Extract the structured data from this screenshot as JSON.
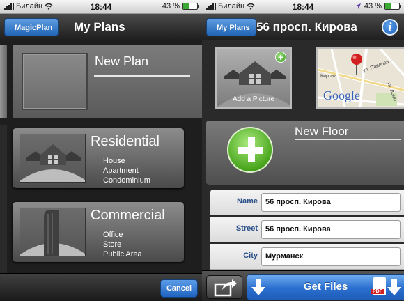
{
  "status_left": {
    "carrier": "Билайн",
    "time": "18:44",
    "battery": "43 %",
    "battery_level": 0.43
  },
  "status_right": {
    "carrier": "Билайн",
    "time": "18:44",
    "battery": "43 %",
    "battery_level": 0.43
  },
  "left": {
    "back_label": "MagicPlan",
    "title": "My Plans",
    "new_plan_label": "New Plan",
    "residential": {
      "title": "Residential",
      "items": [
        "House",
        "Apartment",
        "Condominium"
      ]
    },
    "commercial": {
      "title": "Commercial",
      "items": [
        "Office",
        "Store",
        "Public Area"
      ]
    },
    "cancel_label": "Cancel"
  },
  "right": {
    "back_label": "My Plans",
    "title": "56 просп. Кирова",
    "info_label": "i",
    "add_picture_label": "Add a Picture",
    "map": {
      "brand": "Google",
      "streets": [
        "Кирова",
        "ул. Павлова",
        "ул. Ломо"
      ]
    },
    "new_floor_label": "New Floor",
    "fields": {
      "name": {
        "label": "Name",
        "value": "56 просп. Кирова"
      },
      "street": {
        "label": "Street",
        "value": "56 просп. Кирова"
      },
      "city": {
        "label": "City",
        "value": "Мурманск"
      }
    },
    "get_files_label": "Get Files",
    "pdf_label": "PDF"
  },
  "colors": {
    "accent_blue": "#2a6fd0",
    "plus_green": "#4aa61d",
    "label_blue": "#2b4f88"
  }
}
